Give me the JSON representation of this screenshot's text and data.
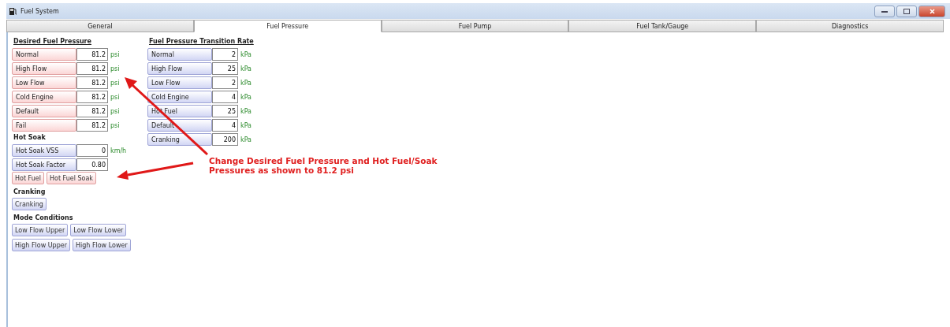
{
  "window": {
    "title": "Fuel System"
  },
  "tabs": [
    {
      "label": "General",
      "selected": false
    },
    {
      "label": "Fuel Pressure",
      "selected": true
    },
    {
      "label": "Fuel Pump",
      "selected": false
    },
    {
      "label": "Fuel Tank/Gauge",
      "selected": false
    },
    {
      "label": "Diagnostics",
      "selected": false
    }
  ],
  "desired_fuel_pressure": {
    "heading": "Desired Fuel Pressure",
    "rows": [
      {
        "label": "Normal",
        "value": "81.2",
        "unit": "psi",
        "kind": "warm"
      },
      {
        "label": "High Flow",
        "value": "81.2",
        "unit": "psi",
        "kind": "warm"
      },
      {
        "label": "Low Flow",
        "value": "81.2",
        "unit": "psi",
        "kind": "warm"
      },
      {
        "label": "Cold Engine",
        "value": "81.2",
        "unit": "psi",
        "kind": "warm"
      },
      {
        "label": "Default",
        "value": "81.2",
        "unit": "psi",
        "kind": "warm"
      },
      {
        "label": "Fail",
        "value": "81.2",
        "unit": "psi",
        "kind": "warm"
      }
    ]
  },
  "hot_soak": {
    "heading": "Hot Soak",
    "rows": [
      {
        "label": "Hot Soak VSS",
        "value": "0",
        "unit": "km/h",
        "kind": "cool"
      },
      {
        "label": "Hot Soak Factor",
        "value": "0.80",
        "kind": "cool"
      }
    ],
    "buttons": [
      {
        "label": "Hot Fuel",
        "kind": "warm"
      },
      {
        "label": "Hot Fuel Soak",
        "kind": "warm"
      }
    ]
  },
  "cranking": {
    "heading": "Cranking",
    "buttons": [
      {
        "label": "Cranking",
        "kind": "cool"
      }
    ]
  },
  "mode_conditions": {
    "heading": "Mode Conditions",
    "buttons": [
      {
        "label": "Low Flow Upper",
        "kind": "cool"
      },
      {
        "label": "Low Flow Lower",
        "kind": "cool"
      },
      {
        "label": "High Flow Upper",
        "kind": "cool"
      },
      {
        "label": "High Flow Lower",
        "kind": "cool"
      }
    ]
  },
  "fuel_pressure_transition_rate": {
    "heading": "Fuel Pressure Transition Rate",
    "rows": [
      {
        "label": "Normal",
        "value": "2",
        "unit": "kPa",
        "kind": "cool"
      },
      {
        "label": "High Flow",
        "value": "25",
        "unit": "kPa",
        "kind": "cool"
      },
      {
        "label": "Low Flow",
        "value": "2",
        "unit": "kPa",
        "kind": "cool"
      },
      {
        "label": "Cold Engine",
        "value": "4",
        "unit": "kPa",
        "kind": "cool"
      },
      {
        "label": "Hot Fuel",
        "value": "25",
        "unit": "kPa",
        "kind": "cool"
      },
      {
        "label": "Default",
        "value": "4",
        "unit": "kPa",
        "kind": "cool"
      },
      {
        "label": "Cranking",
        "value": "200",
        "unit": "kPa",
        "kind": "cool"
      }
    ]
  },
  "annotation": {
    "lines": [
      "Change Desired Fuel Pressure and Hot Fuel/Soak",
      "Pressures as shown to 81.2 psi"
    ]
  }
}
